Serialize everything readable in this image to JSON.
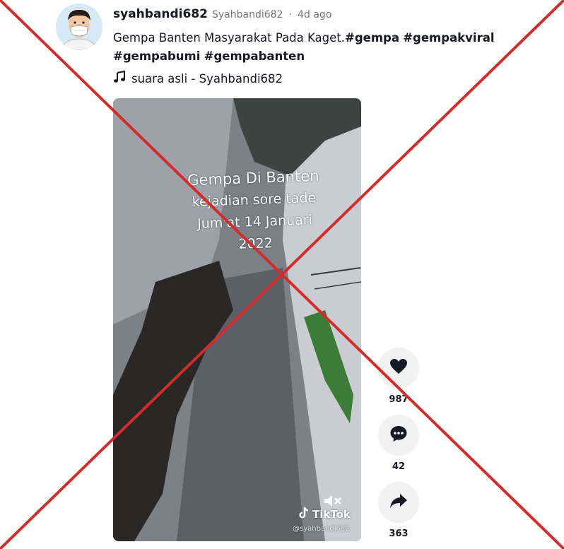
{
  "post": {
    "username": "syahbandi682",
    "nickname": "Syahbandi682",
    "separator": "·",
    "time_ago": "4d ago",
    "caption_text": "Gempa Banten Masyarakat Pada Kaget.",
    "hashtags": [
      "#gempa",
      "#gempakviral",
      "#gempabumi",
      "#gempabanten"
    ],
    "music": "suara asli - Syahbandi682"
  },
  "video": {
    "overlay_lines": [
      "Gempa Di Banten",
      "kejadian sore tade",
      "Jum'at 14 Januari",
      "2022"
    ],
    "watermark_brand": "TikTok",
    "watermark_handle": "@syahbandi682"
  },
  "actions": {
    "likes": "987",
    "comments": "42",
    "shares": "363"
  },
  "colors": {
    "cross": "#d42b2b",
    "text": "#161823",
    "muted": "#757575",
    "action_bg": "#f1f1f2"
  }
}
